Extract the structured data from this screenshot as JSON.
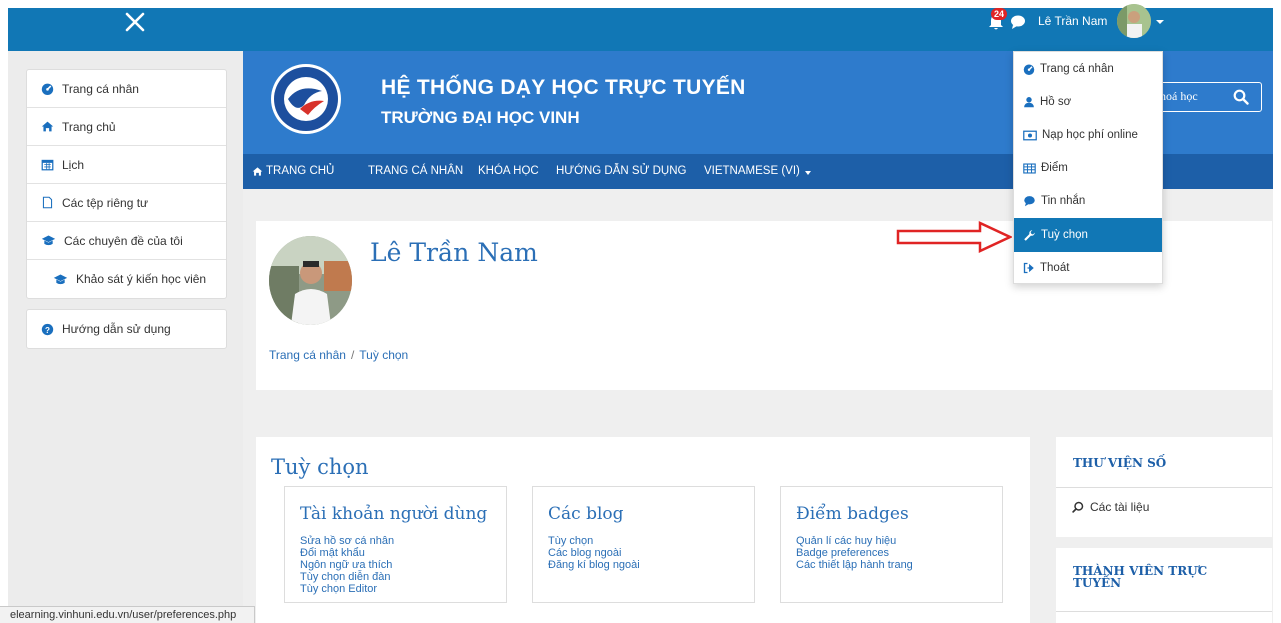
{
  "topbar": {
    "notifications_count": "24",
    "user_name": "Lê Trần Nam"
  },
  "sidebar": {
    "items": [
      {
        "label": "Trang cá nhân",
        "icon": "dashboard-icon"
      },
      {
        "label": "Trang chủ",
        "icon": "home-icon"
      },
      {
        "label": "Lịch",
        "icon": "calendar-icon"
      },
      {
        "label": "Các tệp riêng tư",
        "icon": "file-icon"
      },
      {
        "label": "Các chuyên đề của tôi",
        "icon": "graduation-cap-icon"
      },
      {
        "label": "Khảo sát ý kiến học viên",
        "icon": "graduation-cap-icon"
      }
    ],
    "help": {
      "label": "Hướng dẫn sử dụng",
      "icon": "question-circle-icon"
    }
  },
  "header": {
    "title": "HỆ THỐNG DẠY HỌC TRỰC TUYẾN",
    "subtitle": "TRƯỜNG ĐẠI HỌC VINH",
    "search_text": "khoá học"
  },
  "nav": {
    "home": "TRANG CHỦ",
    "profile": "TRANG CÁ NHÂN",
    "courses": "KHÓA HỌC",
    "guide": "HƯỚNG DẪN SỬ DỤNG",
    "language": "VIETNAMESE (VI)"
  },
  "profile": {
    "name": "Lê Trần Nam",
    "breadcrumb": [
      "Trang cá nhân",
      "Tuỳ chọn"
    ]
  },
  "preferences": {
    "title": "Tuỳ chọn",
    "sections": [
      {
        "heading": "Tài khoản người dùng",
        "links": [
          "Sửa hồ sơ cá nhân",
          "Đổi mật khẩu",
          "Ngôn ngữ ưa thích",
          "Tùy chọn diễn đàn",
          "Tùy chọn Editor"
        ]
      },
      {
        "heading": "Các blog",
        "links": [
          "Tùy chọn",
          "Các blog ngoài",
          "Đăng kí blog ngoài"
        ]
      },
      {
        "heading": "Điểm badges",
        "links": [
          "Quản lí các huy hiệu",
          "Badge preferences",
          "Các thiết lập hành trang"
        ]
      }
    ]
  },
  "right": {
    "library_title": "THƯ VIỆN SỐ",
    "library_item": "Các tài liệu",
    "online_title": "THÀNH VIÊN TRỰC TUYẾN"
  },
  "dropdown": {
    "items": [
      {
        "label": "Trang cá nhân",
        "icon": "dashboard-icon"
      },
      {
        "label": "Hồ sơ",
        "icon": "user-icon"
      },
      {
        "label": "Nạp học phí online",
        "icon": "money-icon"
      },
      {
        "label": "Điểm",
        "icon": "table-icon"
      },
      {
        "label": "Tin nhắn",
        "icon": "comment-icon"
      },
      {
        "label": "Tuỳ chọn",
        "icon": "wrench-icon",
        "active": true
      },
      {
        "label": "Thoát",
        "icon": "sign-out-icon"
      }
    ]
  },
  "status_bar": {
    "url": "elearning.vinhuni.edu.vn/user/preferences.php"
  },
  "colors": {
    "topbar": "#1177b5",
    "header": "#2e7bcc",
    "navbar": "#1d5fa8",
    "link": "#2b6fb6",
    "arrow": "#e02424"
  }
}
